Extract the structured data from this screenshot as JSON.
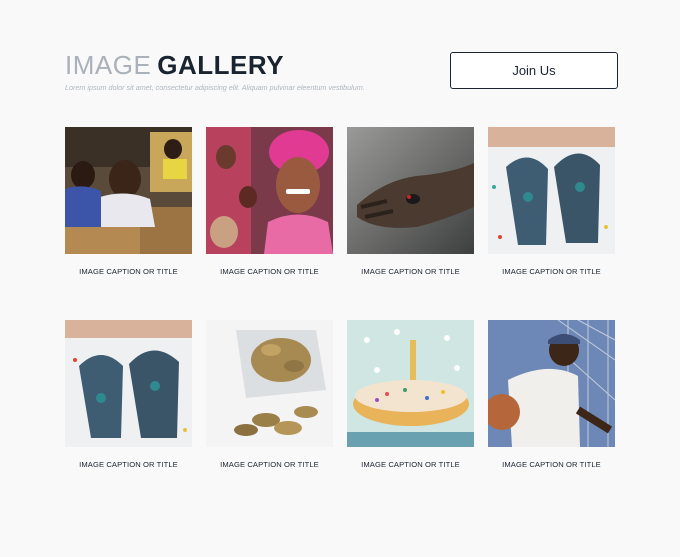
{
  "header": {
    "title_light": "IMAGE",
    "title_bold": "GALLERY",
    "subtitle": "Lorem ipsum dolor sit amet, consectetur adipiscing elit. Aliquam pulvinar eleentum vestibulum.",
    "join_label": "Join Us"
  },
  "gallery": {
    "items": [
      {
        "caption": "IMAGE CAPTION OR TITLE"
      },
      {
        "caption": "IMAGE CAPTION OR TITLE"
      },
      {
        "caption": "IMAGE CAPTION OR TITLE"
      },
      {
        "caption": "IMAGE CAPTION OR TITLE"
      },
      {
        "caption": "IMAGE CAPTION OR TITLE"
      },
      {
        "caption": "IMAGE CAPTION OR TITLE"
      },
      {
        "caption": "IMAGE CAPTION OR TITLE"
      },
      {
        "caption": "IMAGE CAPTION OR TITLE"
      }
    ]
  }
}
